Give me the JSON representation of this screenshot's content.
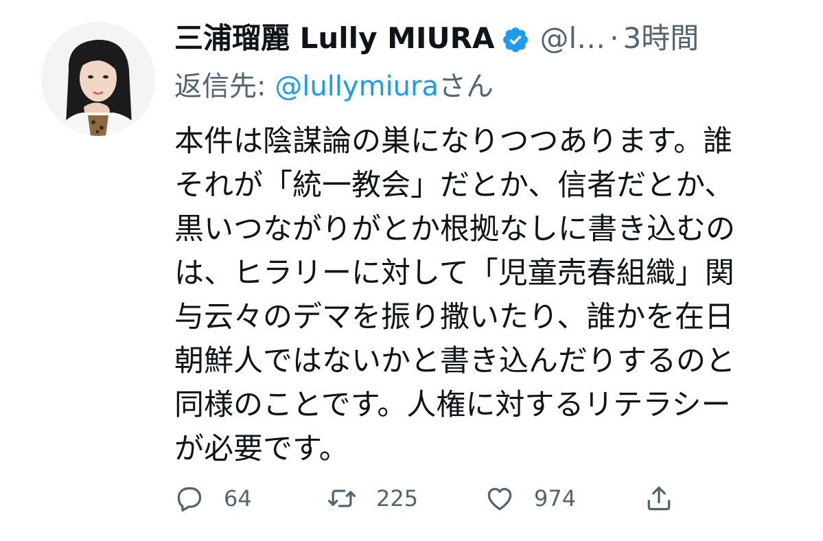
{
  "tweet": {
    "author": {
      "display_name": "三浦瑠麗 Lully MIURA",
      "handle": "@l…",
      "verified": true
    },
    "separator": "·",
    "time": "3時間",
    "reply_to": {
      "prefix": "返信先: ",
      "mention": "@lullymiura",
      "suffix": "さん"
    },
    "body_lines": [
      "本件は陰謀論の巣になりつつあります。誰",
      "それが「統一教会」だとか、信者だとか、",
      "黒いつながりがとか根拠なしに書き込むの",
      "は、ヒラリーに対して「児童売春組織」関",
      "与云々のデマを振り撒いたり、誰かを在日",
      "朝鮮人ではないかと書き込んだりするのと",
      "同様のことです。人権に対するリテラシー",
      "が必要です。"
    ],
    "actions": {
      "reply": {
        "icon": "comment-icon",
        "count": "64"
      },
      "retweet": {
        "icon": "retweet-icon",
        "count": "225"
      },
      "like": {
        "icon": "heart-icon",
        "count": "974"
      },
      "share": {
        "icon": "share-icon"
      }
    }
  },
  "colors": {
    "text_primary": "#0f1419",
    "text_secondary": "#536471",
    "accent": "#1d9bf0"
  }
}
